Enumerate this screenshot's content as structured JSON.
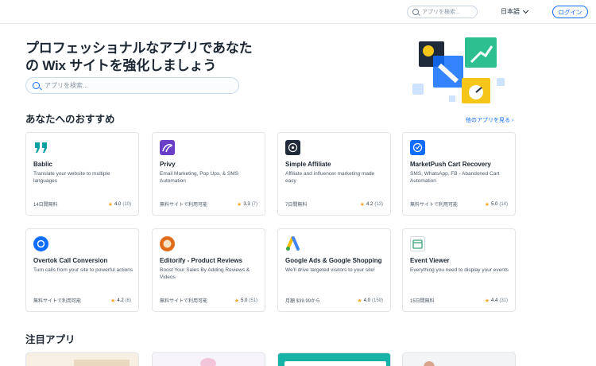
{
  "header": {
    "search_placeholder": "アプリを検索...",
    "language": "日本語",
    "login_label": "ログイン"
  },
  "hero": {
    "title": "プロフェッショナルなアプリであなたの Wix サイトを強化しましょう",
    "search_placeholder": "アプリを検索..."
  },
  "recommended": {
    "title": "あなたへのおすすめ",
    "see_more": "他のアプリを見る ›",
    "apps": [
      {
        "name": "Bablic",
        "desc": "Translate your website to multiple languages",
        "price": "14日間無料",
        "rating": "4.0",
        "count": "(10)",
        "logo": "quote-icon",
        "color": "#0aa1a5"
      },
      {
        "name": "Privy",
        "desc": "Email Marketing, Pop Ups, & SMS Automation",
        "price": "無料サイトで利用可能",
        "rating": "3.3",
        "count": "(7)",
        "logo": "privy-logo",
        "color": "#6a3ec7"
      },
      {
        "name": "Simple Affiliate",
        "desc": "Affiliate and influencer marketing made easy",
        "price": "7日間無料",
        "rating": "4.2",
        "count": "(13)",
        "logo": "affiliate-logo",
        "color": "#1f2b3a"
      },
      {
        "name": "MarketPush Cart Recovery",
        "desc": "SMS, WhatsApp, FB - Abandoned Cart Automation",
        "price": "無料サイトで利用可能",
        "rating": "5.0",
        "count": "(14)",
        "logo": "marketpush-logo",
        "color": "#116dff"
      },
      {
        "name": "Overtok Call Conversion",
        "desc": "Turn calls from your site to powerful actions",
        "price": "無料サイトで利用可能",
        "rating": "4.2",
        "count": "(6)",
        "logo": "overtok-logo",
        "color": "#116dff"
      },
      {
        "name": "Editorify - Product Reviews",
        "desc": "Boost Your Sales By Adding Reviews & Videos",
        "price": "無料サイトで利用可能",
        "rating": "5.0",
        "count": "(51)",
        "logo": "editorify-logo",
        "color": "#e06c1b"
      },
      {
        "name": "Google Ads & Google Shopping",
        "desc": "We'll drive targeted visitors to your site!",
        "price": "月額 $39.99から",
        "rating": "4.0",
        "count": "(159)",
        "logo": "google-ads-logo",
        "color": "#4285f4"
      },
      {
        "name": "Event Viewer",
        "desc": "Everything you need to display your events",
        "price": "15日間無料",
        "rating": "4.4",
        "count": "(31)",
        "logo": "event-viewer-logo",
        "color": "#3aa57a"
      }
    ]
  },
  "featured": {
    "title": "注目アプリ"
  }
}
